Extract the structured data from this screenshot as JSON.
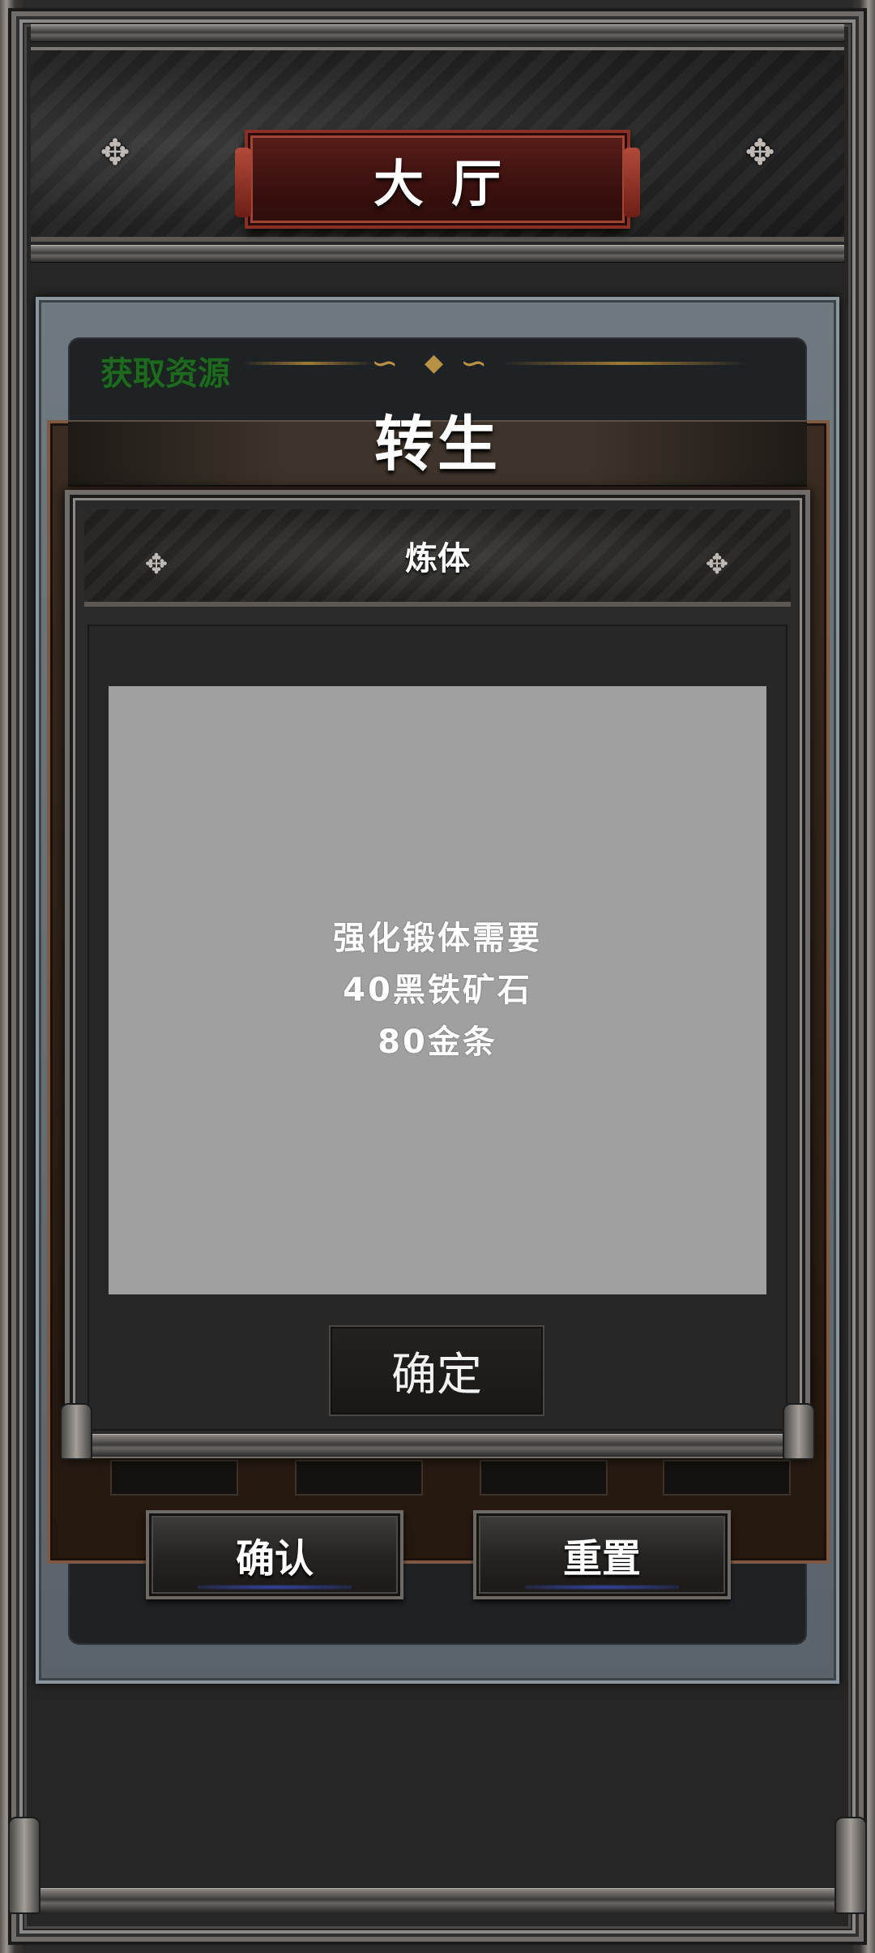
{
  "lobby": {
    "title": "大厅"
  },
  "rebirth_panel": {
    "side_label": "获取资源",
    "title": "转生",
    "confirm_label": "确认",
    "reset_label": "重置"
  },
  "refine_dialog": {
    "title": "炼体",
    "message": {
      "line1": "强化锻体需要",
      "line2": "40黑铁矿石",
      "line3": "80金条"
    },
    "ok_label": "确定"
  },
  "icons": {
    "header_ornament": "ornament-icon",
    "gold_swirl": "gold-swirl-icon"
  },
  "colors": {
    "title_plate": "#5a1e1a",
    "resource_label": "#1f7a1f",
    "message_box": "#a0a0a0",
    "slate_panel": "#6f7a80"
  }
}
